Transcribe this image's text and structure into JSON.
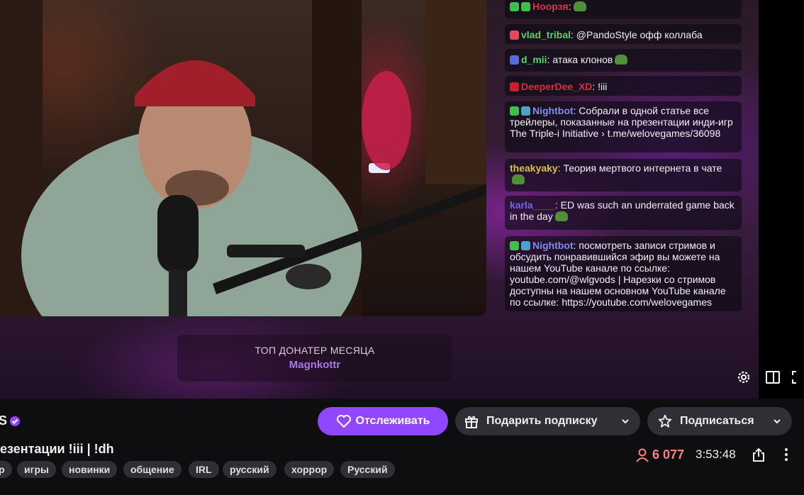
{
  "chat": {
    "messages": [
      {
        "user": "Ноорзя",
        "user_color": "#e0304a",
        "text": ":",
        "badges": [
          "#3fbf4a",
          "#3fbf4a"
        ],
        "emote": true
      },
      {
        "user": "vlad_tribal",
        "user_color": "#5bd46a",
        "text": ": @PandoStyle офф коллаба",
        "badges": [
          "#e04a5a"
        ]
      },
      {
        "user": "d_mii",
        "user_color": "#5bd46a",
        "text": ": атака клонов",
        "badges": [
          "#5a6ad8"
        ],
        "emote": true
      },
      {
        "user": "DeeperDee_XD",
        "user_color": "#e02a3a",
        "text": ": !iii",
        "badges": [
          "#c81e2e"
        ]
      },
      {
        "user": "Nightbot",
        "user_color": "#7e8ee8",
        "text": ": Собрали в одной статье все трейлеры, показанные на презентации инди-игр The Triple-i Initiative › t.me/welovegames/36098",
        "badges": [
          "#3fbf4a",
          "#4aa3c8"
        ]
      },
      {
        "user": "theakyaky",
        "user_color": "#d8c24a",
        "text": ": Теория мертвого интернета в чате",
        "badges": [],
        "emote": true
      },
      {
        "user": "karla____",
        "user_color": "#6a6ae0",
        "text": ": ED was such an underrated game back in the day",
        "badges": [],
        "emote": true
      },
      {
        "user": "Nightbot",
        "user_color": "#7e8ee8",
        "text": ": посмотреть записи стримов и обсудить понравившийся эфир вы можете на нашем YouTube канале по ссылке: youtube.com/@wlgvods | Нарезки со стримов доступны на нашем основном YouTube канале по ссылке: https://youtube.com/welovegames",
        "badges": [
          "#3fbf4a",
          "#4aa3c8"
        ]
      }
    ]
  },
  "overlay": {
    "donater_label": "ТОП ДОНАТЕР МЕСЯЦА",
    "donater_name": "Magnkottr"
  },
  "player_controls": {
    "icons": [
      "gear-icon",
      "sidebar-toggle-icon",
      "fullscreen-icon"
    ]
  },
  "channel": {
    "name_fragment": "S",
    "title_fragment": "езентации !iii | !dh",
    "viewers": "6 077",
    "uptime": "3:53:48",
    "tags": [
      "р",
      "игры",
      "новинки",
      "общение",
      "IRL",
      "русский",
      "хоррор",
      "Русский"
    ]
  },
  "actions": {
    "follow": "Отслеживать",
    "gift": "Подарить подписку",
    "subscribe": "Подписаться"
  },
  "colors": {
    "accent": "#9147ff",
    "viewers": "#ff8280",
    "tag_bg": "#2f2f35"
  }
}
